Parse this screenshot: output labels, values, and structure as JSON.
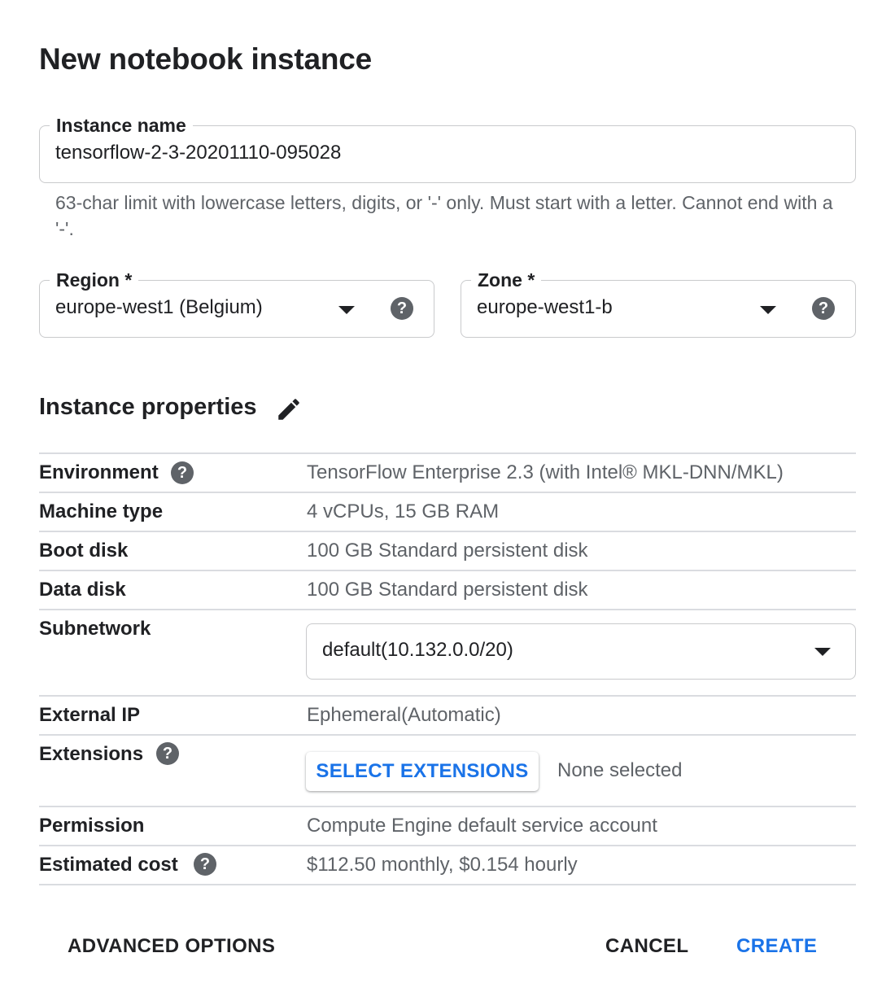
{
  "dialog": {
    "title": "New notebook instance"
  },
  "instance_name": {
    "label": "Instance name",
    "value": "tensorflow-2-3-20201110-095028",
    "hint": "63-char limit with lowercase letters, digits, or '-' only. Must start with a letter. Cannot end with a '-'."
  },
  "region": {
    "label": "Region *",
    "value": "europe-west1 (Belgium)"
  },
  "zone": {
    "label": "Zone *",
    "value": "europe-west1-b"
  },
  "instance_properties": {
    "title": "Instance properties",
    "environment": {
      "label": "Environment",
      "value": "TensorFlow Enterprise 2.3 (with Intel® MKL-DNN/MKL)"
    },
    "machine_type": {
      "label": "Machine type",
      "value": "4 vCPUs, 15 GB RAM"
    },
    "boot_disk": {
      "label": "Boot disk",
      "value": "100 GB Standard persistent disk"
    },
    "data_disk": {
      "label": "Data disk",
      "value": "100 GB Standard persistent disk"
    },
    "subnetwork": {
      "label": "Subnetwork",
      "value": "default(10.132.0.0/20)"
    },
    "external_ip": {
      "label": "External IP",
      "value": "Ephemeral(Automatic)"
    },
    "extensions": {
      "label": "Extensions",
      "button_label": "SELECT EXTENSIONS",
      "status": "None selected"
    },
    "permission": {
      "label": "Permission",
      "value": "Compute Engine default service account"
    },
    "estimated_cost": {
      "label": "Estimated cost",
      "value": "$112.50 monthly, $0.154 hourly"
    }
  },
  "footer": {
    "advanced_label": "ADVANCED OPTIONS",
    "cancel_label": "CANCEL",
    "create_label": "CREATE"
  },
  "icons": {
    "help": "?",
    "help_icon_name": "help-circle-icon",
    "edit_icon_name": "pencil-icon",
    "dropdown_icon_name": "dropdown-caret-icon"
  },
  "colors": {
    "accent": "#1a73e8",
    "muted_text": "#5f6368",
    "divider": "#dadce0"
  }
}
